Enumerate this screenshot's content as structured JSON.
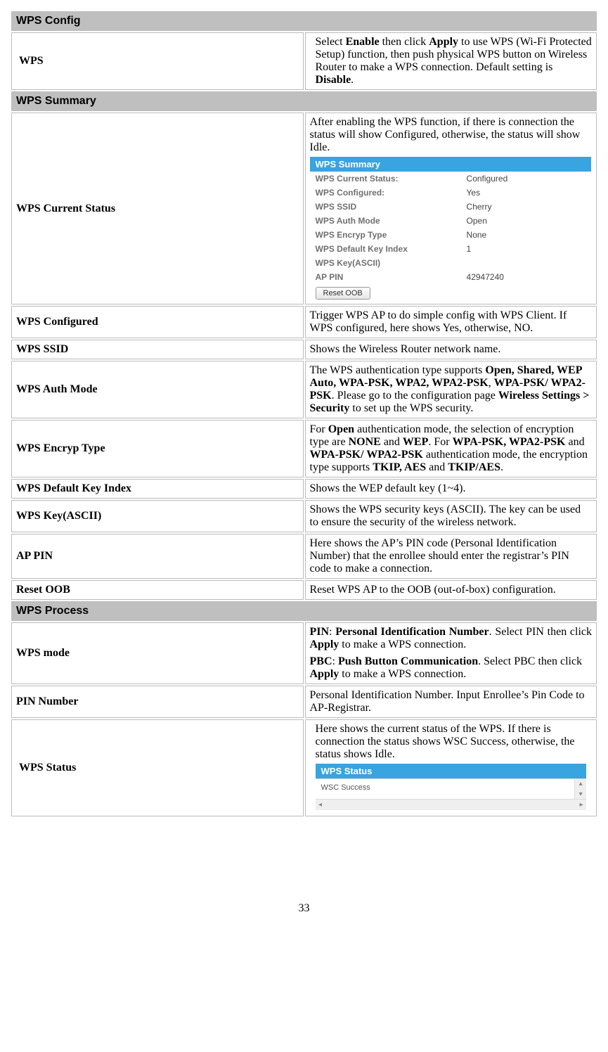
{
  "sections": {
    "config": "WPS Config",
    "summary": "WPS Summary",
    "process": "WPS Process"
  },
  "rows": {
    "wps": {
      "label": "WPS",
      "desc_pre": "Select ",
      "desc_b1": "Enable",
      "desc_mid1": " then click ",
      "desc_b2": "Apply",
      "desc_mid2": " to use WPS (Wi-Fi Protected Setup) function, then push physical WPS button on Wireless  Router to make a WPS connection. Default setting is ",
      "desc_b3": "Disable",
      "desc_end": "."
    },
    "cur_status": {
      "label": "WPS Current Status",
      "desc": "After enabling the WPS function, if there is connection the status will show Configured, otherwise, the status will show Idle."
    },
    "configured": {
      "label": "WPS Configured",
      "desc": "Trigger WPS AP to do simple config with WPS Client. If WPS configured, here shows Yes, otherwise, NO."
    },
    "ssid": {
      "label": "WPS SSID",
      "desc": "Shows the Wireless  Router network name."
    },
    "auth": {
      "label": "WPS Auth Mode",
      "pre": "The WPS authentication type supports ",
      "b1": "Open, Shared, WEP Auto, WPA-PSK, WPA2, WPA2-PSK",
      "mid1": ", ",
      "b2": "WPA-PSK/ WPA2-PSK",
      "mid2": ". Please go to the configuration page ",
      "b3": "Wireless Settings > Security",
      "end": " to set up the WPS security."
    },
    "encryp": {
      "label": "WPS Encryp Type",
      "pre": "For ",
      "b1": "Open",
      "mid1": " authentication mode, the selection of encryption type are ",
      "b2": "NONE",
      "mid2": " and ",
      "b3": "WEP",
      "mid3": ". For ",
      "b4": "WPA-PSK, WPA2-PSK",
      "mid4": " and ",
      "b5": "WPA-PSK/ WPA2-PSK",
      "mid5": " authentication mode, the encryption type supports ",
      "b6": "TKIP, AES",
      "mid6": " and ",
      "b7": "TKIP/AES",
      "end": "."
    },
    "keyidx": {
      "label": "WPS Default Key Index",
      "desc": "Shows the WEP default key (1~4)."
    },
    "keyascii": {
      "label": "WPS Key(ASCII)",
      "desc": "Shows the WPS security keys (ASCII). The key can be used to ensure the security of the wireless network."
    },
    "appin": {
      "label": "AP PIN",
      "desc": "Here shows the AP’s PIN code (Personal Identification Number) that the enrollee should enter the registrar’s PIN code to make a connection."
    },
    "resetoob": {
      "label": "Reset OOB",
      "desc": "Reset WPS AP to the OOB (out-of-box) configuration."
    },
    "mode": {
      "label": "WPS mode",
      "p1_b1": "PIN",
      "p1_mid1": ": ",
      "p1_b2": "Personal Identification Number",
      "p1_mid2": ". Select PIN then click ",
      "p1_b3": "Apply",
      "p1_end": " to make a WPS connection.",
      "p2_b1": "PBC",
      "p2_mid1": ": ",
      "p2_b2": "Push Button Communication",
      "p2_mid2": ". Select PBC then click ",
      "p2_b3": "Apply",
      "p2_end": " to make a WPS connection."
    },
    "pin": {
      "label": "PIN Number",
      "desc": "Personal Identification Number. Input Enrollee’s Pin Code to AP-Registrar."
    },
    "status": {
      "label": "WPS Status",
      "desc": "Here shows the current status of the WPS. If there is connection the status shows WSC Success, otherwise, the status shows Idle."
    }
  },
  "summary_panel": {
    "header": "WPS Summary",
    "items": [
      {
        "k": "WPS Current Status:",
        "v": "Configured"
      },
      {
        "k": "WPS Configured:",
        "v": "Yes"
      },
      {
        "k": "WPS SSID",
        "v": "Cherry"
      },
      {
        "k": "WPS Auth Mode",
        "v": "Open"
      },
      {
        "k": "WPS Encryp Type",
        "v": "None"
      },
      {
        "k": "WPS Default Key Index",
        "v": "1"
      },
      {
        "k": "WPS Key(ASCII)",
        "v": ""
      },
      {
        "k": "AP PIN",
        "v": "42947240"
      }
    ],
    "button": "Reset OOB"
  },
  "status_panel": {
    "header": "WPS Status",
    "value": "WSC Success"
  },
  "page_number": "33"
}
